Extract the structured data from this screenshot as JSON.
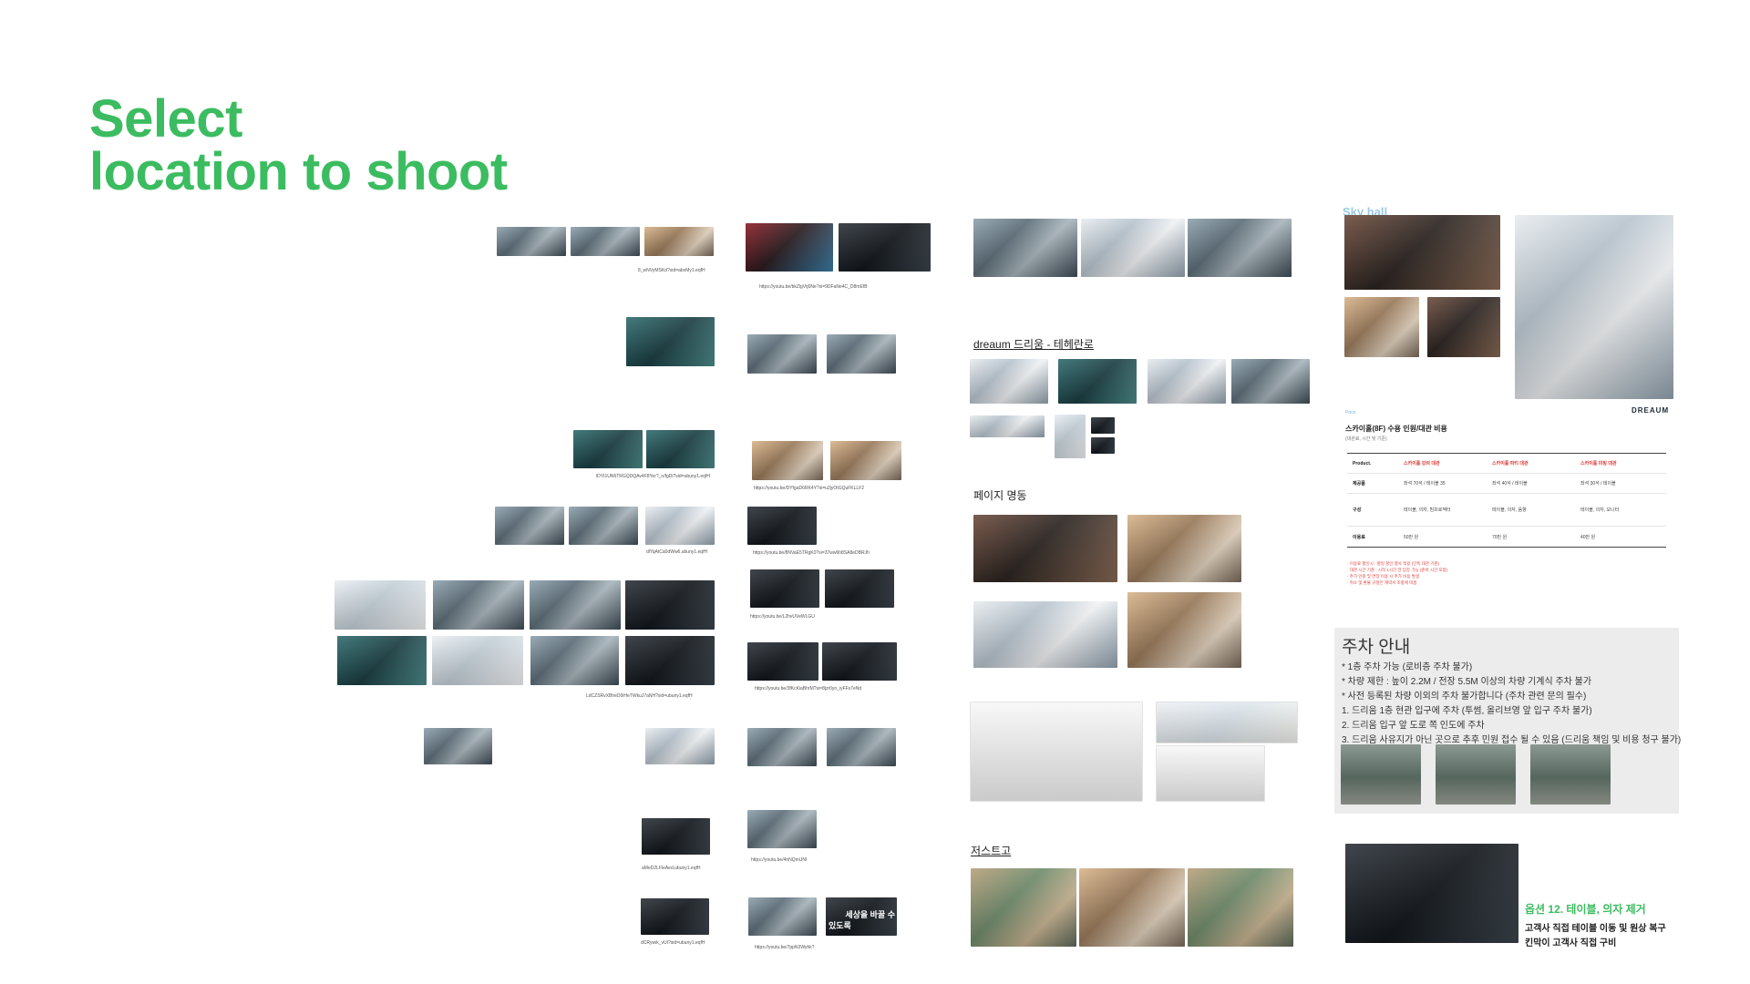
{
  "title": {
    "line1": "Select",
    "line2": "location to shoot"
  },
  "captions": {
    "c1": "8_wNVyMSKd?sid=abxMy1.eqfH",
    "c2": "https://youtu.be/bkZlgVtj0Ne?si=9DFaNe4C_D8mEfB",
    "c3": "lDYt1UN6TRGQDQAv4F8Yer?_n/fgDi?sid=ubuny1.eqfH",
    "c4": "https://youtu.be/DYfgaD6RK4Y?si=u2jyOtGQuFKLLF2",
    "c5": "dlYqAtCa0dWw6.ubuny1.eqfH",
    "c6": "https://youtu.be/8NVaE5TRgK0?si=37ww6h8SA8eDBRJh",
    "c7": "https://youtu.be/L2hvUVeWLGU",
    "c8": "LdCZSRvXBheD0iHeTWkuJ7aNH?sid=ubuny1.eqfH",
    "c9": "https://youtu.be/3fKcKiaBhrM?si=8jzr0yo_iyFFs7eNd",
    "c10": "aMeD2LFleAed.ubuny1.eqfH",
    "c11": "https://youtu.be/4nNQmiJNI",
    "c12": "dCRywik_vUt?sid=ubuny1.eqfH",
    "c13": "https://youtu.be/7ppN3Wyhk?"
  },
  "sections": {
    "dreaum": "dreaum 드리움 - 테헤란로",
    "page": "페이지 명동",
    "just": "저스트고",
    "skyhall": "Sky hall"
  },
  "thumb_text": {
    "t1": "세상을 바꿀 수",
    "t2": "있도록"
  },
  "sky": {
    "brand": "DREAUM",
    "price": "Price",
    "table_title": "스카이홀(8F) 수용 인원/대관 비용",
    "table_sub": "(대관료, 시간 및 기준)",
    "head": [
      "Product.",
      "스카이홀 강의 대관",
      "스카이홀 파티 대관",
      "스카이홀 미팅 대관"
    ],
    "rows": [
      [
        "제공품",
        "좌석 70석 / 테이블 35",
        "좌석 40석 / 테이블",
        "좌석 30석 / 테이블"
      ],
      [
        "구성",
        "테이블, 의자, 빔프로젝터",
        "테이블, 의자, 음향",
        "테이블, 의자, 모니터"
      ],
      [
        "이용료",
        "50만 원",
        "70만 원",
        "40만 원"
      ]
    ],
    "notes": [
      "· 이용료 할인시 : 평일 할인 행사 적용 (단독 대관 기준)",
      "· 대관 시간 기준 : 시작 1시간 전 입장 가능 (준비 시간 포함)",
      "· 추가 인원 및 연장 이용 시 추가 비용 발생",
      "· 취소 및 환불 규정은 계약서 조항에 따름"
    ]
  },
  "parking": {
    "title": "주차 안내",
    "lines": [
      "* 1층 주차 가능 (로비층 주차 불가)",
      "* 차량 제한 : 높이 2.2M / 전장 5.5M 이상의 차량 기계식 주차 불가",
      "* 사전 등록된 차량 이외의 주차 불가합니다 (주차 관련 문의 필수)",
      "1. 드리움 1층 현관 입구에 주차 (투썸, 올리브영 앞 입구 주차 불가)",
      "2. 드리움 입구 앞 도로 쪽 인도에 주차",
      "3. 드리움 사유지가 아닌 곳으로 추후 민원 접수 될 수 있음 (드리움 책임 및 비용 청구 불가)"
    ]
  },
  "option": {
    "title": "옵션 12. 테이블, 의자 제거",
    "line1": "고객사 직접 테이블 이동 및 원상 복구",
    "line2": "킨막이 고객사 직접 구비"
  }
}
